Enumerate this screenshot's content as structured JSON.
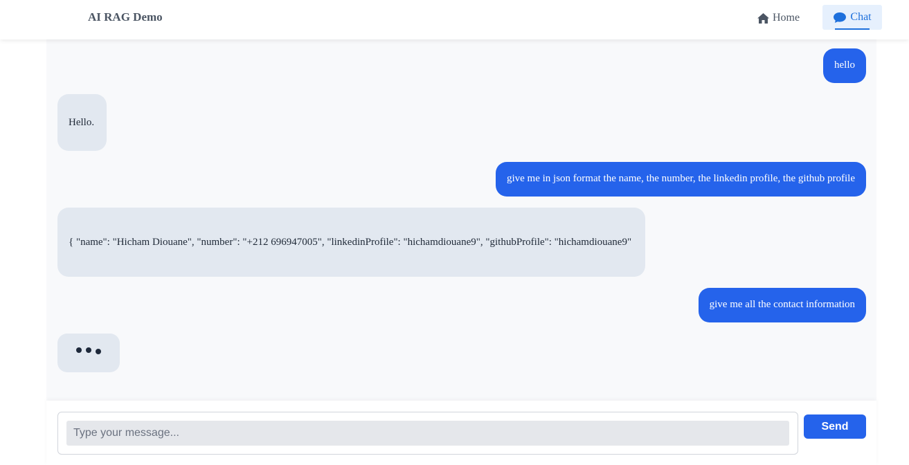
{
  "header": {
    "brand": "AI RAG Demo",
    "nav": [
      {
        "label": "Home",
        "icon": "home-icon"
      },
      {
        "label": "Chat",
        "icon": "chat-bubble-icon",
        "active": true
      }
    ]
  },
  "messages": [
    {
      "role": "user",
      "text": "hello"
    },
    {
      "role": "bot",
      "text": "Hello."
    },
    {
      "role": "user",
      "text": "give me in json format the name, the number, the linkedin profile, the github profile"
    },
    {
      "role": "bot",
      "text": "{ \"name\": \"Hicham Diouane\", \"number\": \"+212 696947005\", \"linkedinProfile\": \"hichamdiouane9\", \"githubProfile\": \"hichamdiouane9\""
    },
    {
      "role": "user",
      "text": "give me all the contact information"
    }
  ],
  "composer": {
    "placeholder": "Type your message...",
    "value": "",
    "send_label": "Send"
  },
  "colors": {
    "accent": "#2563eb",
    "bot_bubble": "#e2e8f0",
    "chat_bg": "#f8f9fb",
    "nav_active_bg": "#e6f0fd",
    "nav_active_text": "#1d6fdc"
  }
}
